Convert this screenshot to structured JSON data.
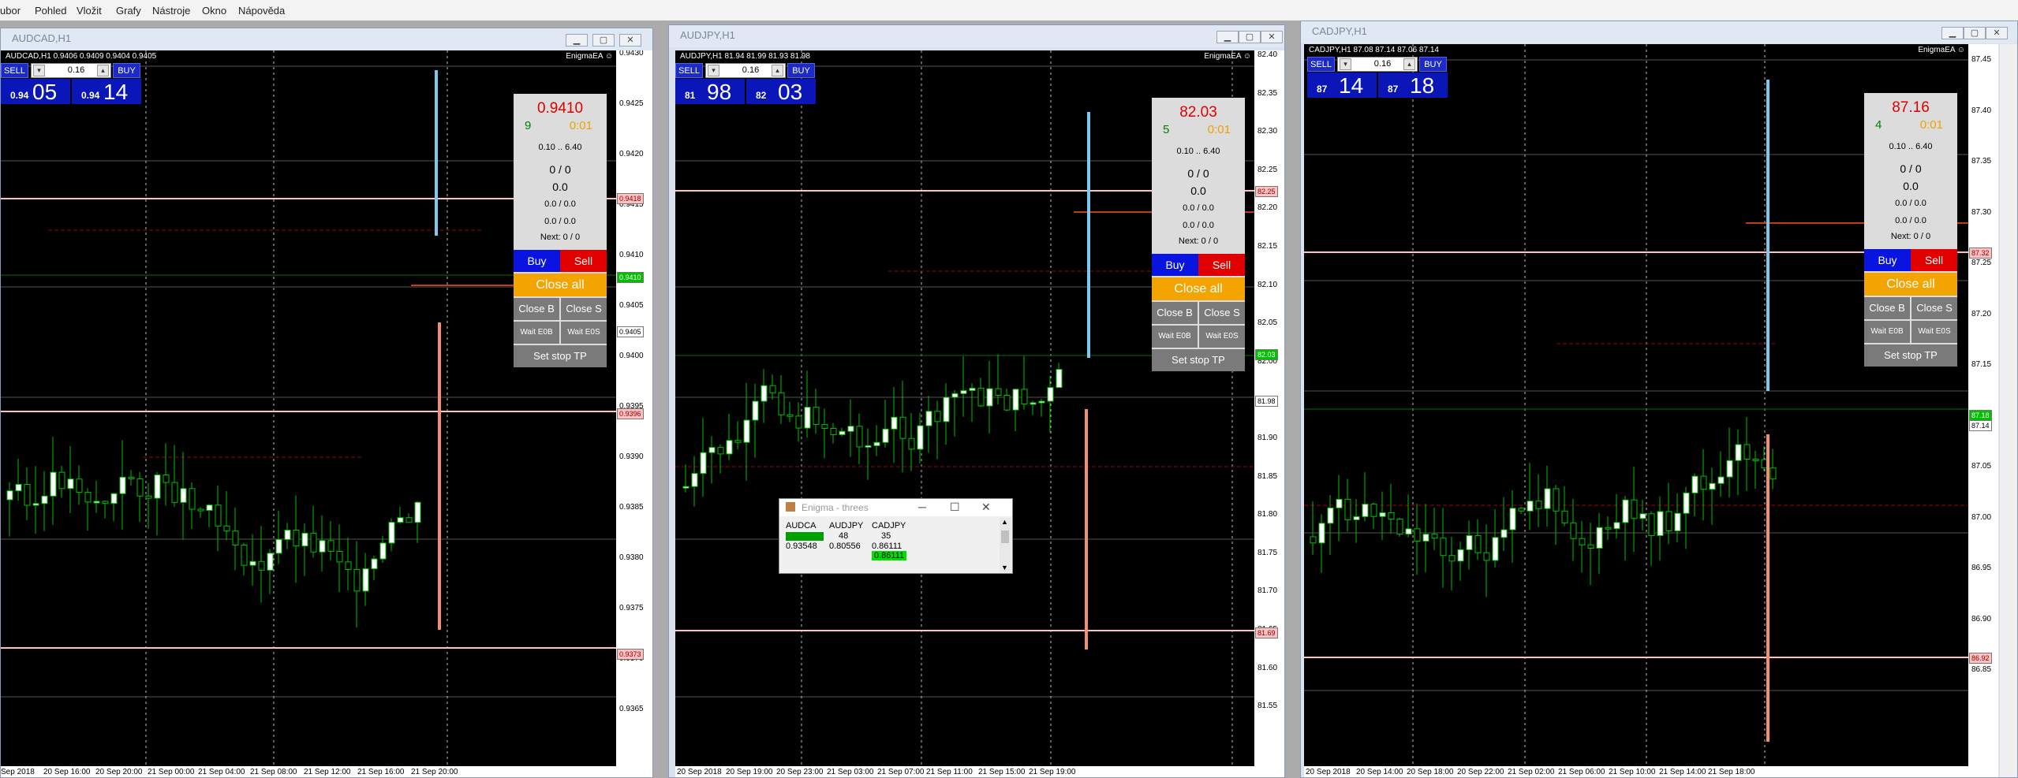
{
  "menu": [
    "ubor",
    "Pohled",
    "Vložit",
    "Grafy",
    "Nástroje",
    "Okno",
    "Nápověda"
  ],
  "windows": [
    {
      "title": "AUDCAD,H1",
      "symbol_line": "AUDCAD,H1  0.9406 0.9409 0.9404 0.9405",
      "ea": "EnigmaEA ☺",
      "trade": {
        "sell": "SELL",
        "buy": "BUY",
        "lot": "0.16",
        "bid_small": "0.94",
        "bid_big": "05",
        "ask_small": "0.94",
        "ask_big": "14"
      },
      "panel": {
        "price": "0.9410",
        "count": "9",
        "time": "0:01",
        "range": "0.10 .. 6.40",
        "l1": "0 / 0",
        "l2": "0.0",
        "l3": "0.0 / 0.0",
        "l4": "0.0 / 0.0",
        "next": "Next: 0 / 0",
        "buy": "Buy",
        "sell": "Sell",
        "closeall": "Close all",
        "closeb": "Close B",
        "closes": "Close S",
        "waitb": "Wait E0B",
        "waits": "Wait E0S",
        "setstop": "Set stop TP"
      },
      "price_ticks": [
        "0.9430",
        "0.9425",
        "0.9420",
        "0.9415",
        "0.9410",
        "0.9405",
        "0.9400",
        "0.9395",
        "0.9390",
        "0.9385",
        "0.9380",
        "0.9375",
        "0.9370",
        "0.9365"
      ],
      "price_labels": [
        {
          "t": "0.9418",
          "c": "pink"
        },
        {
          "t": "0.9410",
          "c": "green"
        },
        {
          "t": "0.9405",
          "c": "white"
        },
        {
          "t": "0.9396",
          "c": "pink"
        },
        {
          "t": "0.9373",
          "c": "pink"
        }
      ],
      "time_ticks": [
        "Sep 2018",
        "20 Sep 16:00",
        "20 Sep 20:00",
        "21 Sep 00:00",
        "21 Sep 04:00",
        "21 Sep 08:00",
        "21 Sep 12:00",
        "21 Sep 16:00",
        "21 Sep 20:00"
      ]
    },
    {
      "title": "AUDJPY,H1",
      "symbol_line": "AUDJPY,H1  81.94 81.99 81.93 81.98",
      "ea": "EnigmaEA ☺",
      "trade": {
        "sell": "SELL",
        "buy": "BUY",
        "lot": "0.16",
        "bid_small": "81",
        "bid_big": "98",
        "ask_small": "82",
        "ask_big": "03"
      },
      "panel": {
        "price": "82.03",
        "count": "5",
        "time": "0:01",
        "range": "0.10 .. 6.40",
        "l1": "0 / 0",
        "l2": "0.0",
        "l3": "0.0 / 0.0",
        "l4": "0.0 / 0.0",
        "next": "Next: 0 / 0",
        "buy": "Buy",
        "sell": "Sell",
        "closeall": "Close all",
        "closeb": "Close B",
        "closes": "Close S",
        "waitb": "Wait E0B",
        "waits": "Wait E0S",
        "setstop": "Set stop TP"
      },
      "price_ticks": [
        "82.40",
        "82.35",
        "82.30",
        "82.25",
        "82.20",
        "82.15",
        "82.10",
        "82.05",
        "82.00",
        "81.95",
        "81.90",
        "81.85",
        "81.80",
        "81.75",
        "81.70",
        "81.65",
        "81.60",
        "81.55"
      ],
      "price_labels": [
        {
          "t": "82.25",
          "c": "pink"
        },
        {
          "t": "82.03",
          "c": "green"
        },
        {
          "t": "81.98",
          "c": "white"
        },
        {
          "t": "81.69",
          "c": "pink"
        }
      ],
      "time_ticks": [
        "20 Sep 2018",
        "20 Sep 19:00",
        "20 Sep 23:00",
        "21 Sep 03:00",
        "21 Sep 07:00",
        "21 Sep 11:00",
        "21 Sep 15:00",
        "21 Sep 19:00"
      ]
    },
    {
      "title": "CADJPY,H1",
      "symbol_line": "CADJPY,H1  87.08 87.14 87.06 87.14",
      "ea": "EnigmaEA ☺",
      "trade": {
        "sell": "SELL",
        "buy": "BUY",
        "lot": "0.16",
        "bid_small": "87",
        "bid_big": "14",
        "ask_small": "87",
        "ask_big": "18"
      },
      "panel": {
        "price": "87.16",
        "count": "4",
        "time": "0:01",
        "range": "0.10 .. 6.40",
        "l1": "0 / 0",
        "l2": "0.0",
        "l3": "0.0 / 0.0",
        "l4": "0.0 / 0.0",
        "next": "Next: 0 / 0",
        "buy": "Buy",
        "sell": "Sell",
        "closeall": "Close all",
        "closeb": "Close B",
        "closes": "Close S",
        "waitb": "Wait E0B",
        "waits": "Wait E0S",
        "setstop": "Set stop TP"
      },
      "price_ticks": [
        "87.45",
        "87.40",
        "87.35",
        "87.30",
        "87.25",
        "87.20",
        "87.15",
        "87.10",
        "87.05",
        "87.00",
        "86.95",
        "86.90",
        "86.85"
      ],
      "price_labels": [
        {
          "t": "87.32",
          "c": "pink"
        },
        {
          "t": "87.18",
          "c": "green"
        },
        {
          "t": "87.14",
          "c": "white"
        },
        {
          "t": "86.92",
          "c": "pink"
        }
      ],
      "time_ticks": [
        "20 Sep 2018",
        "20 Sep 14:00",
        "20 Sep 18:00",
        "20 Sep 22:00",
        "21 Sep 02:00",
        "21 Sep 06:00",
        "21 Sep 10:00",
        "21 Sep 14:00",
        "21 Sep 18:00"
      ]
    }
  ],
  "popup": {
    "title": "Enigma - threes",
    "headers": [
      "AUDCA",
      "AUDJPY",
      "CADJPY"
    ],
    "counts": [
      "",
      "48",
      "35"
    ],
    "values": [
      "0.93548",
      "0.80556",
      "0.86111"
    ],
    "highlight": "0.86111"
  },
  "colors": {
    "candle_bull": "#ffffff",
    "candle_bear": "#000000",
    "candle_border": "#00c000",
    "pink_line": "#ffc0c0",
    "sell_line": "#ff8060",
    "buy_line": "#7ec8f0"
  }
}
